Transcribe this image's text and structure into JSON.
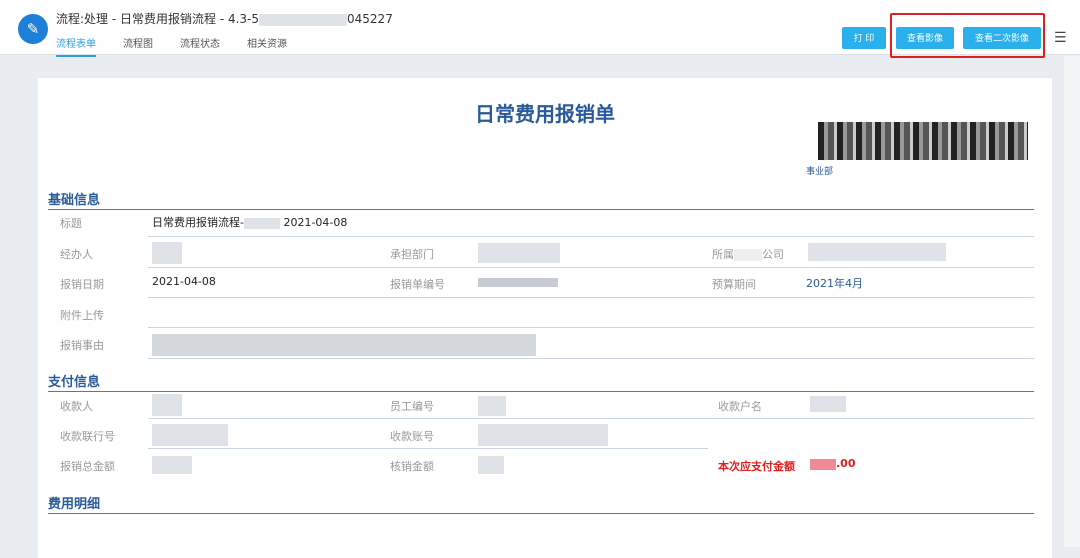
{
  "header": {
    "title_prefix": "流程:处理 - 日常费用报销流程 - 4.3-5",
    "title_suffix": "045227",
    "logo_icon": "app-logo-icon",
    "tabs": [
      "流程表单",
      "流程图",
      "流程状态",
      "相关资源"
    ],
    "buttons": {
      "print": "打 印",
      "view_image": "查看影像",
      "view_second_image": "查看二次影像"
    }
  },
  "form": {
    "title": "日常费用报销单",
    "dept": "事业部",
    "sections": {
      "basic": "基础信息",
      "payment": "支付信息",
      "details": "费用明细"
    },
    "basic": {
      "subject_label": "标题",
      "subject_prefix": "日常费用报销流程-",
      "subject_date": "2021-04-08",
      "handler_label": "经办人",
      "dept_label": "承担部门",
      "company_label_a": "所属",
      "company_label_b": "公司",
      "date_label": "报销日期",
      "date_value": "2021-04-08",
      "number_label": "报销单编号",
      "period_label": "预算期间",
      "period_value": "2021年4月",
      "attach_label": "附件上传",
      "reason_label": "报销事由"
    },
    "payment": {
      "payee_label": "收款人",
      "emp_no_label": "员工编号",
      "account_name_label": "收款户名",
      "bank_no_label": "收款联行号",
      "account_label": "收款账号",
      "total_label": "报销总金额",
      "writeoff_label": "核销金额",
      "pay_label": "本次应支付金额",
      "pay_suffix": ".00"
    }
  },
  "colors": {
    "accent": "#2ab0ec",
    "highlight": "#e02020",
    "section": "#2a5a9a"
  }
}
